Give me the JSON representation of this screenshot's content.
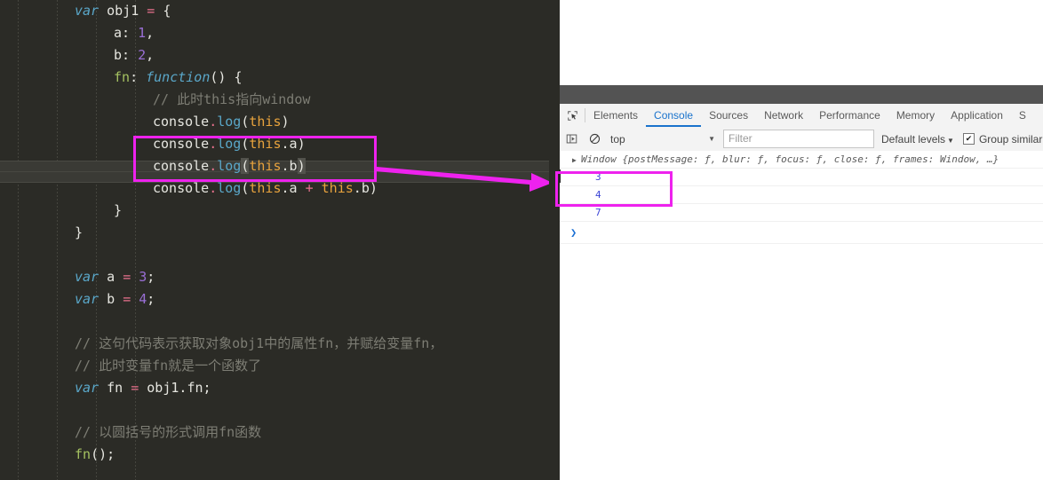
{
  "editor": {
    "language": "javascript",
    "lines": [
      {
        "indent": 1,
        "tokens": [
          {
            "t": "var",
            "c": "kw"
          },
          {
            "t": " ",
            "c": "plain"
          },
          {
            "t": "obj1",
            "c": "plain"
          },
          {
            "t": " ",
            "c": "plain"
          },
          {
            "t": "=",
            "c": "op"
          },
          {
            "t": " {",
            "c": "punc"
          }
        ]
      },
      {
        "indent": 2,
        "tokens": [
          {
            "t": "a",
            "c": "plain"
          },
          {
            "t": ": ",
            "c": "punc"
          },
          {
            "t": "1",
            "c": "num"
          },
          {
            "t": ",",
            "c": "punc"
          }
        ]
      },
      {
        "indent": 2,
        "tokens": [
          {
            "t": "b",
            "c": "plain"
          },
          {
            "t": ": ",
            "c": "punc"
          },
          {
            "t": "2",
            "c": "num"
          },
          {
            "t": ",",
            "c": "punc"
          }
        ]
      },
      {
        "indent": 2,
        "tokens": [
          {
            "t": "fn",
            "c": "prop"
          },
          {
            "t": ": ",
            "c": "punc"
          },
          {
            "t": "function",
            "c": "kw"
          },
          {
            "t": "() {",
            "c": "punc"
          }
        ]
      },
      {
        "indent": 3,
        "tokens": [
          {
            "t": "// 此时this指向window",
            "c": "comment"
          }
        ]
      },
      {
        "indent": 3,
        "tokens": [
          {
            "t": "console",
            "c": "obj"
          },
          {
            "t": ".",
            "c": "dot"
          },
          {
            "t": "log",
            "c": "meth"
          },
          {
            "t": "(",
            "c": "punc"
          },
          {
            "t": "this",
            "c": "thisk"
          },
          {
            "t": ")",
            "c": "punc"
          }
        ]
      },
      {
        "indent": 3,
        "tokens": [
          {
            "t": "console",
            "c": "obj"
          },
          {
            "t": ".",
            "c": "dot"
          },
          {
            "t": "log",
            "c": "meth"
          },
          {
            "t": "(",
            "c": "punc"
          },
          {
            "t": "this",
            "c": "thisk"
          },
          {
            "t": ".",
            "c": "punc"
          },
          {
            "t": "a",
            "c": "plain"
          },
          {
            "t": ")",
            "c": "punc"
          }
        ]
      },
      {
        "indent": 3,
        "tokens": [
          {
            "t": "console",
            "c": "obj"
          },
          {
            "t": ".",
            "c": "dot"
          },
          {
            "t": "log",
            "c": "meth"
          },
          {
            "t": "(",
            "c": "punc sel"
          },
          {
            "t": "this",
            "c": "thisk"
          },
          {
            "t": ".",
            "c": "punc"
          },
          {
            "t": "b",
            "c": "plain"
          },
          {
            "t": ")",
            "c": "punc sel"
          }
        ]
      },
      {
        "indent": 3,
        "tokens": [
          {
            "t": "console",
            "c": "obj"
          },
          {
            "t": ".",
            "c": "dot"
          },
          {
            "t": "log",
            "c": "meth"
          },
          {
            "t": "(",
            "c": "punc"
          },
          {
            "t": "this",
            "c": "thisk"
          },
          {
            "t": ".",
            "c": "punc"
          },
          {
            "t": "a",
            "c": "plain"
          },
          {
            "t": " ",
            "c": "plain"
          },
          {
            "t": "+",
            "c": "op"
          },
          {
            "t": " ",
            "c": "plain"
          },
          {
            "t": "this",
            "c": "thisk"
          },
          {
            "t": ".",
            "c": "punc"
          },
          {
            "t": "b",
            "c": "plain"
          },
          {
            "t": ")",
            "c": "punc"
          }
        ]
      },
      {
        "indent": 2,
        "tokens": [
          {
            "t": "}",
            "c": "punc"
          }
        ]
      },
      {
        "indent": 1,
        "tokens": [
          {
            "t": "}",
            "c": "punc"
          }
        ]
      },
      {
        "indent": 1,
        "tokens": []
      },
      {
        "indent": 1,
        "tokens": [
          {
            "t": "var",
            "c": "kw"
          },
          {
            "t": " ",
            "c": "plain"
          },
          {
            "t": "a",
            "c": "plain"
          },
          {
            "t": " ",
            "c": "plain"
          },
          {
            "t": "=",
            "c": "op"
          },
          {
            "t": " ",
            "c": "plain"
          },
          {
            "t": "3",
            "c": "num"
          },
          {
            "t": ";",
            "c": "punc"
          }
        ]
      },
      {
        "indent": 1,
        "tokens": [
          {
            "t": "var",
            "c": "kw"
          },
          {
            "t": " ",
            "c": "plain"
          },
          {
            "t": "b",
            "c": "plain"
          },
          {
            "t": " ",
            "c": "plain"
          },
          {
            "t": "=",
            "c": "op"
          },
          {
            "t": " ",
            "c": "plain"
          },
          {
            "t": "4",
            "c": "num"
          },
          {
            "t": ";",
            "c": "punc"
          }
        ]
      },
      {
        "indent": 1,
        "tokens": []
      },
      {
        "indent": 1,
        "tokens": [
          {
            "t": "// 这句代码表示获取对象obj1中的属性fn，并赋给变量fn，",
            "c": "comment"
          }
        ]
      },
      {
        "indent": 1,
        "tokens": [
          {
            "t": "// 此时变量fn就是一个函数了",
            "c": "comment"
          }
        ]
      },
      {
        "indent": 1,
        "tokens": [
          {
            "t": "var",
            "c": "kw"
          },
          {
            "t": " ",
            "c": "plain"
          },
          {
            "t": "fn",
            "c": "plain"
          },
          {
            "t": " ",
            "c": "plain"
          },
          {
            "t": "=",
            "c": "op"
          },
          {
            "t": " ",
            "c": "plain"
          },
          {
            "t": "obj1",
            "c": "plain"
          },
          {
            "t": ".",
            "c": "punc"
          },
          {
            "t": "fn",
            "c": "plain"
          },
          {
            "t": ";",
            "c": "punc"
          }
        ]
      },
      {
        "indent": 1,
        "tokens": []
      },
      {
        "indent": 1,
        "tokens": [
          {
            "t": "// 以圆括号的形式调用fn函数",
            "c": "comment"
          }
        ]
      },
      {
        "indent": 1,
        "tokens": [
          {
            "t": "fn",
            "c": "prop"
          },
          {
            "t": "();",
            "c": "punc"
          }
        ]
      }
    ],
    "current_line_index": 7,
    "background": "#2b2b26"
  },
  "annotations": {
    "color": "#ee22ee",
    "code_highlight_label": "console.log(this.a) / console.log(this.b)",
    "arrow_label": "points-to-console-output",
    "console_highlight_label": "3 / 4"
  },
  "devtools": {
    "inspect_icon": "inspect-element-icon",
    "tabs": [
      {
        "label": "Elements",
        "active": false
      },
      {
        "label": "Console",
        "active": true
      },
      {
        "label": "Sources",
        "active": false
      },
      {
        "label": "Network",
        "active": false
      },
      {
        "label": "Performance",
        "active": false
      },
      {
        "label": "Memory",
        "active": false
      },
      {
        "label": "Application",
        "active": false
      },
      {
        "label": "S",
        "active": false
      }
    ],
    "toolbar": {
      "sidebar_icon": "console-sidebar-icon",
      "clear_icon": "clear-console-icon",
      "context_value": "top",
      "context_caret": "▼",
      "filter_placeholder": "Filter",
      "filter_value": "",
      "levels_label": "Default levels",
      "levels_caret": "▼",
      "group_similar_label": "Group similar",
      "group_similar_checked": true,
      "checkmark": "✔"
    },
    "console": {
      "rows": [
        {
          "kind": "object",
          "expander": "▶",
          "text": "Window {postMessage: ƒ, blur: ƒ, focus: ƒ, close: ƒ, frames: Window, …}"
        },
        {
          "kind": "number",
          "text": "3"
        },
        {
          "kind": "number",
          "text": "4"
        },
        {
          "kind": "number",
          "text": "7"
        }
      ],
      "prompt": "❯"
    },
    "accent": "#1a73cc"
  }
}
